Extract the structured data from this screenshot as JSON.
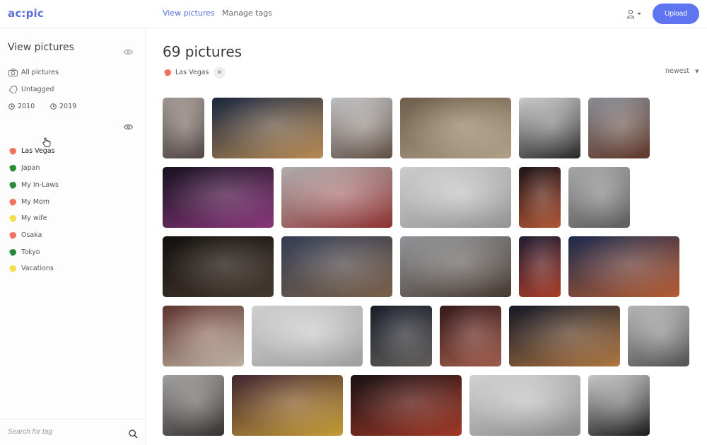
{
  "app": {
    "logo": "ac:pic"
  },
  "nav": {
    "view_pictures": "View pictures",
    "manage_tags": "Manage tags"
  },
  "upload_label": "Upload",
  "sidebar": {
    "title": "View pictures",
    "all_pictures": "All pictures",
    "untagged": "Untagged",
    "years": [
      "2010",
      "2019"
    ],
    "tags": [
      {
        "label": "Las Vegas",
        "color": "#f0725f"
      },
      {
        "label": "Japan",
        "color": "#2a8a3a"
      },
      {
        "label": "My In-Laws",
        "color": "#2a8a3a"
      },
      {
        "label": "My Mom",
        "color": "#f0725f"
      },
      {
        "label": "My wife",
        "color": "#f2e24a"
      },
      {
        "label": "Osaka",
        "color": "#f0725f"
      },
      {
        "label": "Tokyo",
        "color": "#2a8a3a"
      },
      {
        "label": "Vacations",
        "color": "#f2e24a"
      }
    ],
    "search_placeholder": "Search for tag"
  },
  "main": {
    "title": "69 pictures",
    "filter_chip": "Las Vegas",
    "filter_chip_color": "#f0725f",
    "sort_label": "newest"
  },
  "photos": [
    {
      "name": "photo-woman-white-hair-sunglasses",
      "c1": "#b7aca6",
      "c2": "#5d5350"
    },
    {
      "name": "photo-tokyo-night-skyline",
      "c1": "#1d2c48",
      "c2": "#d4a060"
    },
    {
      "name": "photo-japanese-castle",
      "c1": "#d9d9dc",
      "c2": "#6c5b4e"
    },
    {
      "name": "photo-market-alley",
      "c1": "#7c6a55",
      "c2": "#c9b79c"
    },
    {
      "name": "photo-woman-black-hat-portrait",
      "c1": "#e6e6e6",
      "c2": "#2e2e2e"
    },
    {
      "name": "photo-city-street-hdr",
      "c1": "#9aa0a8",
      "c2": "#6e3f2e"
    },
    {
      "name": "photo-neon-street-night",
      "c1": "#1a1526",
      "c2": "#9c3f8b"
    },
    {
      "name": "photo-temple-in-mist",
      "c1": "#c7c4c6",
      "c2": "#a23b3a"
    },
    {
      "name": "photo-old-man-white-room",
      "c1": "#e8e8e8",
      "c2": "#a9a9a9"
    },
    {
      "name": "photo-narrow-neon-alley",
      "c1": "#20161c",
      "c2": "#c9623e"
    },
    {
      "name": "photo-woman-sunglasses-leaning",
      "c1": "#bcbcbc",
      "c2": "#6a6a6a"
    },
    {
      "name": "photo-couple-restaurant-dark",
      "c1": "#15120f",
      "c2": "#4f4136"
    },
    {
      "name": "photo-man-crouching-street",
      "c1": "#3a4660",
      "c2": "#8b6e54"
    },
    {
      "name": "photo-quiet-street-crosswalk",
      "c1": "#a6a9ad",
      "c2": "#51433a"
    },
    {
      "name": "photo-red-neon-signs",
      "c1": "#24213a",
      "c2": "#c0472f"
    },
    {
      "name": "photo-tokyo-tower-night",
      "c1": "#1f3057",
      "c2": "#d06a3a"
    },
    {
      "name": "photo-crowded-shopping-street",
      "c1": "#6b3b35",
      "c2": "#d8cbb8"
    },
    {
      "name": "photo-old-man-desk-window",
      "c1": "#ececec",
      "c2": "#b4b4b4"
    },
    {
      "name": "photo-aerial-crossing-night",
      "c1": "#1c2230",
      "c2": "#6e6a66"
    },
    {
      "name": "photo-arcade-hallway-red",
      "c1": "#3a1c1c",
      "c2": "#b86a58"
    },
    {
      "name": "photo-traffic-light-trails",
      "c1": "#161c2e",
      "c2": "#c8884a"
    },
    {
      "name": "photo-woman-silver-jacket",
      "c1": "#cfcfcf",
      "c2": "#5e5e5e"
    },
    {
      "name": "photo-wedding-couple",
      "c1": "#b8b6b4",
      "c2": "#3d3a38"
    },
    {
      "name": "photo-osaka-lanterns",
      "c1": "#4a2b3a",
      "c2": "#e0b23e"
    },
    {
      "name": "photo-neon-street-rain",
      "c1": "#1a1418",
      "c2": "#b8402c"
    },
    {
      "name": "photo-old-man-desk-tablet",
      "c1": "#efefef",
      "c2": "#9c9c9c"
    },
    {
      "name": "photo-woman-bw-sunglasses",
      "c1": "#e4e4e4",
      "c2": "#1f1f1f"
    }
  ]
}
